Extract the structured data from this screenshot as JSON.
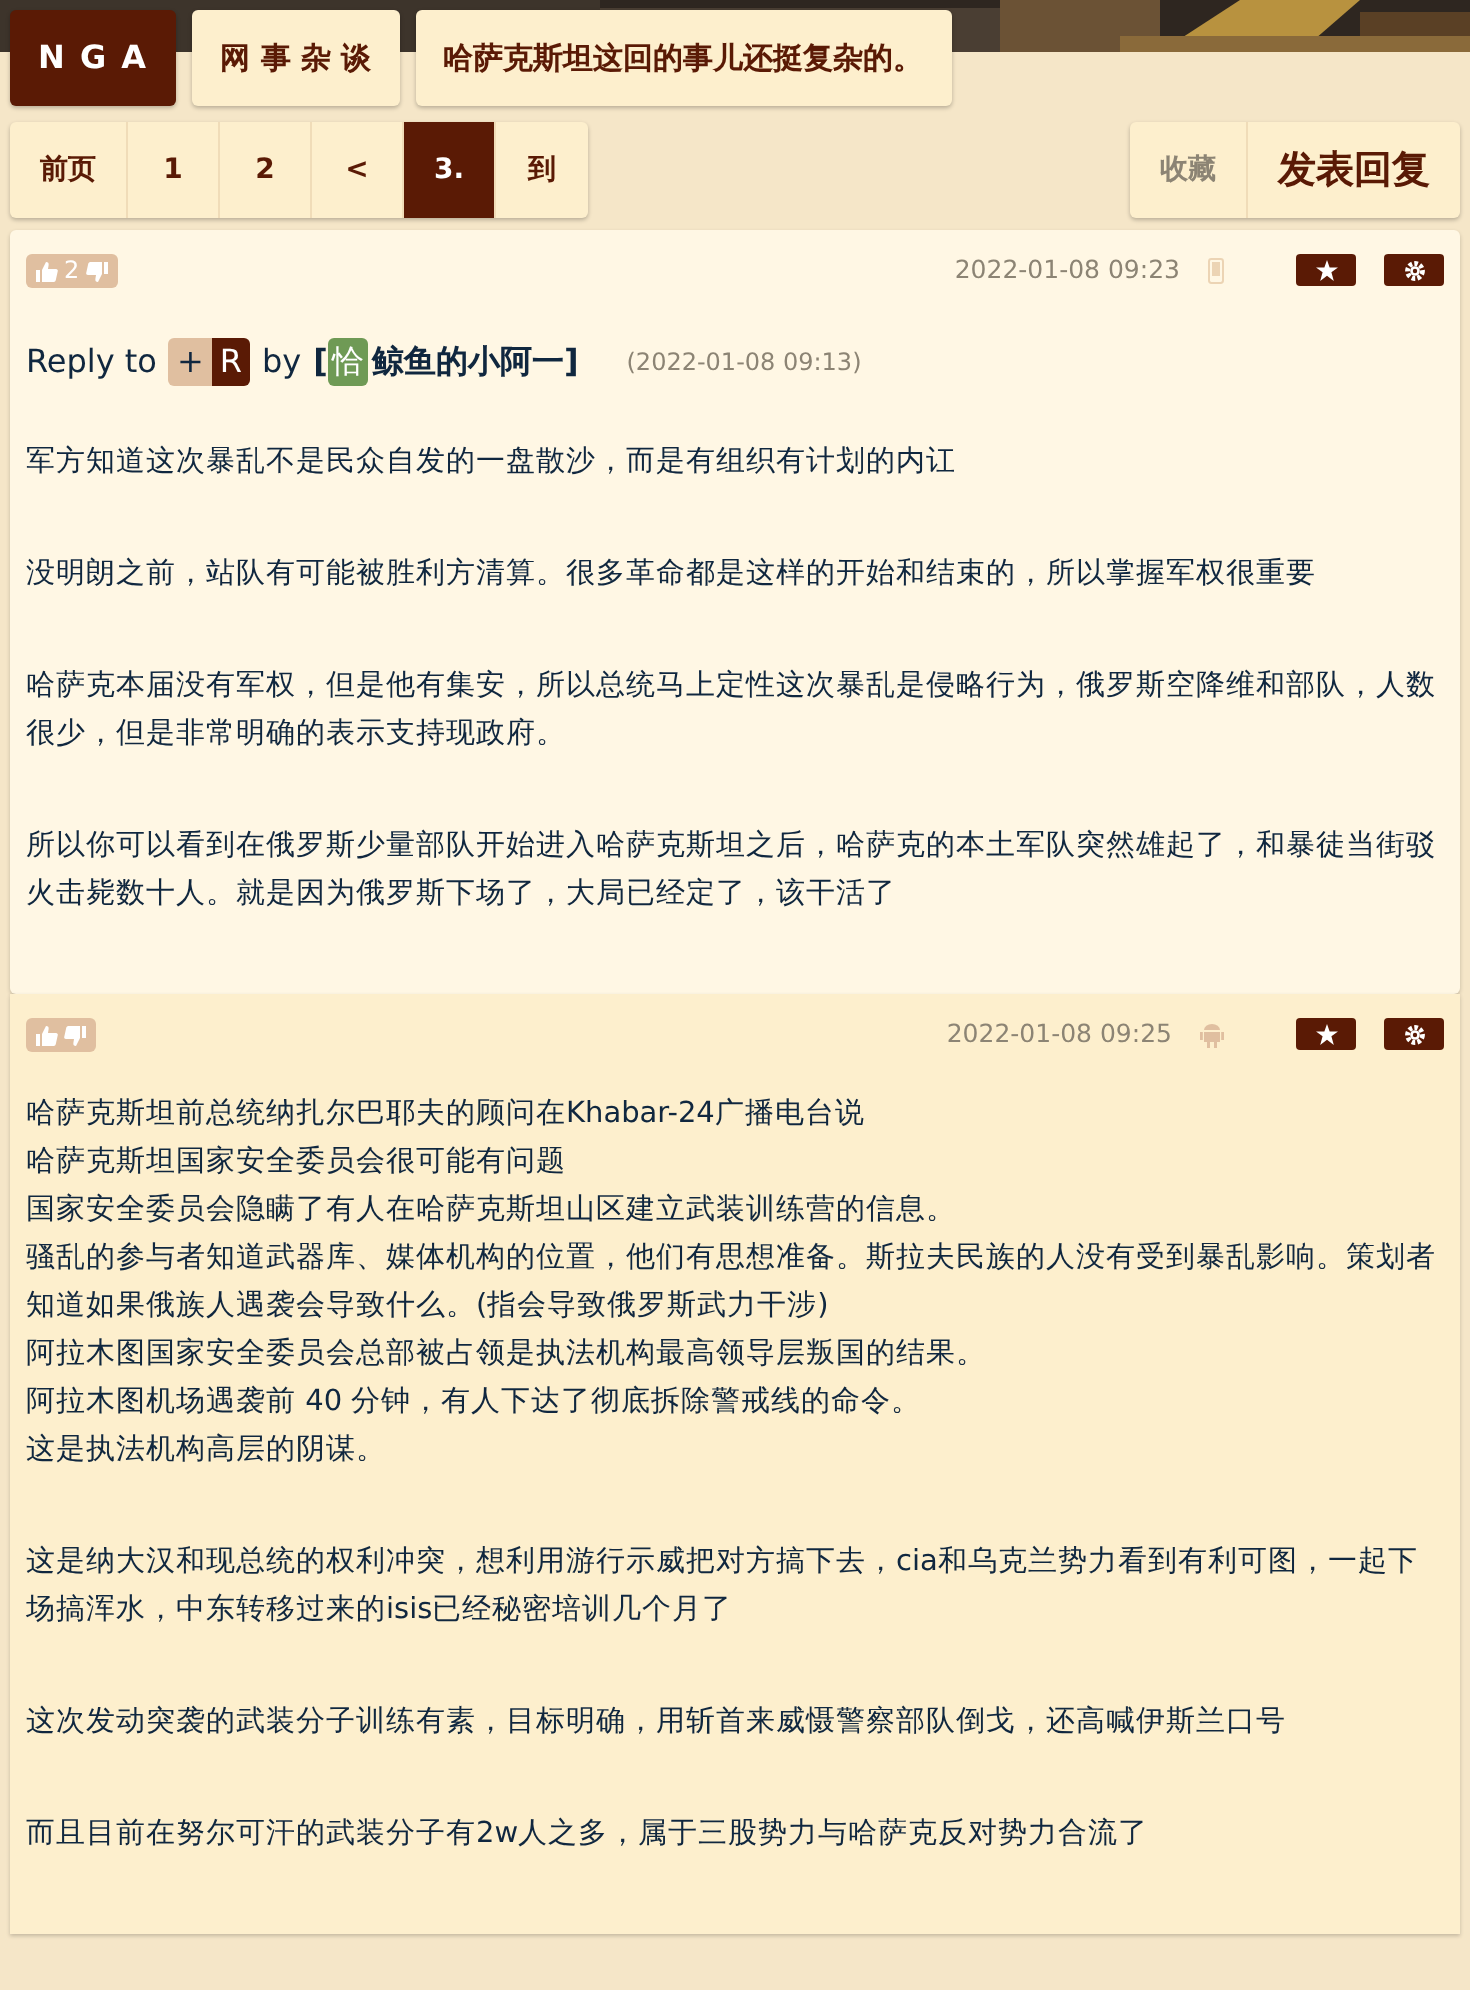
{
  "header": {
    "logo": "N G A",
    "forum": "网 事 杂 谈",
    "title": "哈萨克斯坦这回的事儿还挺复杂的。"
  },
  "pager": [
    {
      "label": "前页",
      "selected": false
    },
    {
      "label": "1",
      "selected": false
    },
    {
      "label": "2",
      "selected": false
    },
    {
      "label": "<",
      "selected": false
    },
    {
      "label": "3.",
      "selected": true
    },
    {
      "label": "到",
      "selected": false
    }
  ],
  "actions": [
    {
      "label": "收藏",
      "kind": "muted"
    },
    {
      "label": "发表回复",
      "kind": "primary"
    }
  ],
  "posts": [
    {
      "votes": "2",
      "date": "2022-01-08 09:23",
      "device": {
        "kind": "phone"
      },
      "reply": {
        "prefix": "Reply to",
        "plus": "+",
        "tag": "R",
        "by": "by",
        "open": "[",
        "badge": "恰",
        "user": "鲸鱼的小阿一",
        "close": "]",
        "time": "(2022-01-08 09:13)"
      },
      "blocks": [
        [
          "军方知道这次暴乱不是民众自发的一盘散沙，而是有组织有计划的内讧"
        ],
        [
          "没明朗之前，站队有可能被胜利方清算。很多革命都是这样的开始和结束的，所以掌握军权很重要"
        ],
        [
          "哈萨克本届没有军权，但是他有集安，所以总统马上定性这次暴乱是侵略行为，俄罗斯空降维和部队，人数很少，但是非常明确的表示支持现政府。"
        ],
        [
          "所以你可以看到在俄罗斯少量部队开始进入哈萨克斯坦之后，哈萨克的本土军队突然雄起了，和暴徒当街驳火击毙数十人。就是因为俄罗斯下场了，大局已经定了，该干活了"
        ]
      ]
    },
    {
      "date": "2022-01-08 09:25",
      "device": {
        "kind": "android"
      },
      "blocks": [
        [
          "哈萨克斯坦前总统纳扎尔巴耶夫的顾问在Khabar-24广播电台说",
          "哈萨克斯坦国家安全委员会很可能有问题",
          "国家安全委员会隐瞒了有人在哈萨克斯坦山区建立武装训练营的信息。",
          "骚乱的参与者知道武器库、媒体机构的位置，他们有思想准备。斯拉夫民族的人没有受到暴乱影响。策划者知道如果俄族人遇袭会导致什么。(指会导致俄罗斯武力干涉)",
          "阿拉木图国家安全委员会总部被占领是执法机构最高领导层叛国的结果。",
          "阿拉木图机场遇袭前 40 分钟，有人下达了彻底拆除警戒线的命令。",
          "这是执法机构高层的阴谋。"
        ],
        [
          "这是纳大汉和现总统的权利冲突，想利用游行示威把对方搞下去，cia和乌克兰势力看到有利可图，一起下场搞浑水，中东转移过来的isis已经秘密培训几个月了"
        ],
        [
          "这次发动突袭的武装分子训练有素，目标明确，用斩首来威慑警察部队倒戈，还高喊伊斯兰口号"
        ],
        [
          "而且目前在努尔可汗的武装分子有2w人之多，属于三股势力与哈萨克反对势力合流了"
        ]
      ]
    }
  ]
}
